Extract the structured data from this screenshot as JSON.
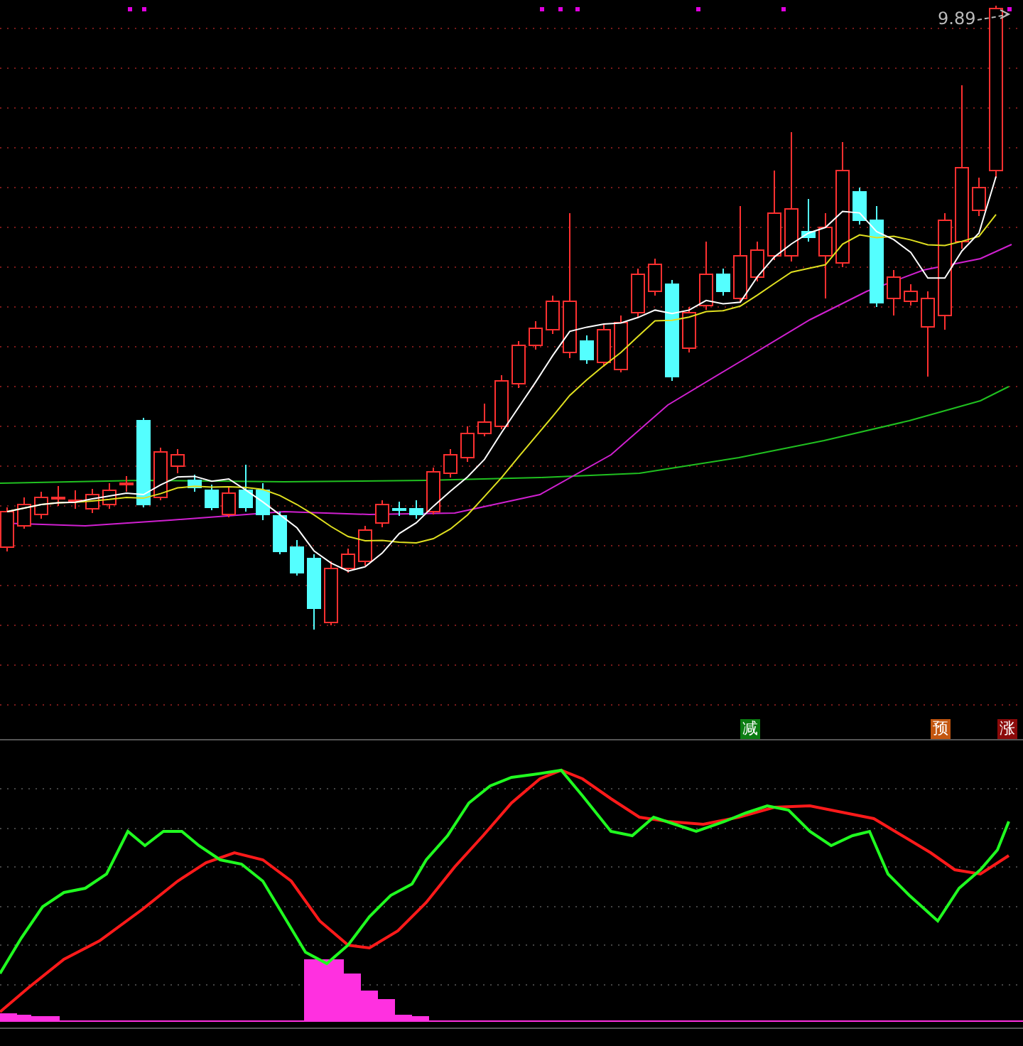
{
  "price_label": {
    "text": "9.89"
  },
  "signals": [
    {
      "text": "减",
      "color": "#0b7d12"
    },
    {
      "text": "预",
      "color": "#c4560f"
    },
    {
      "text": "涨",
      "color": "#8c0a0a"
    }
  ]
}
